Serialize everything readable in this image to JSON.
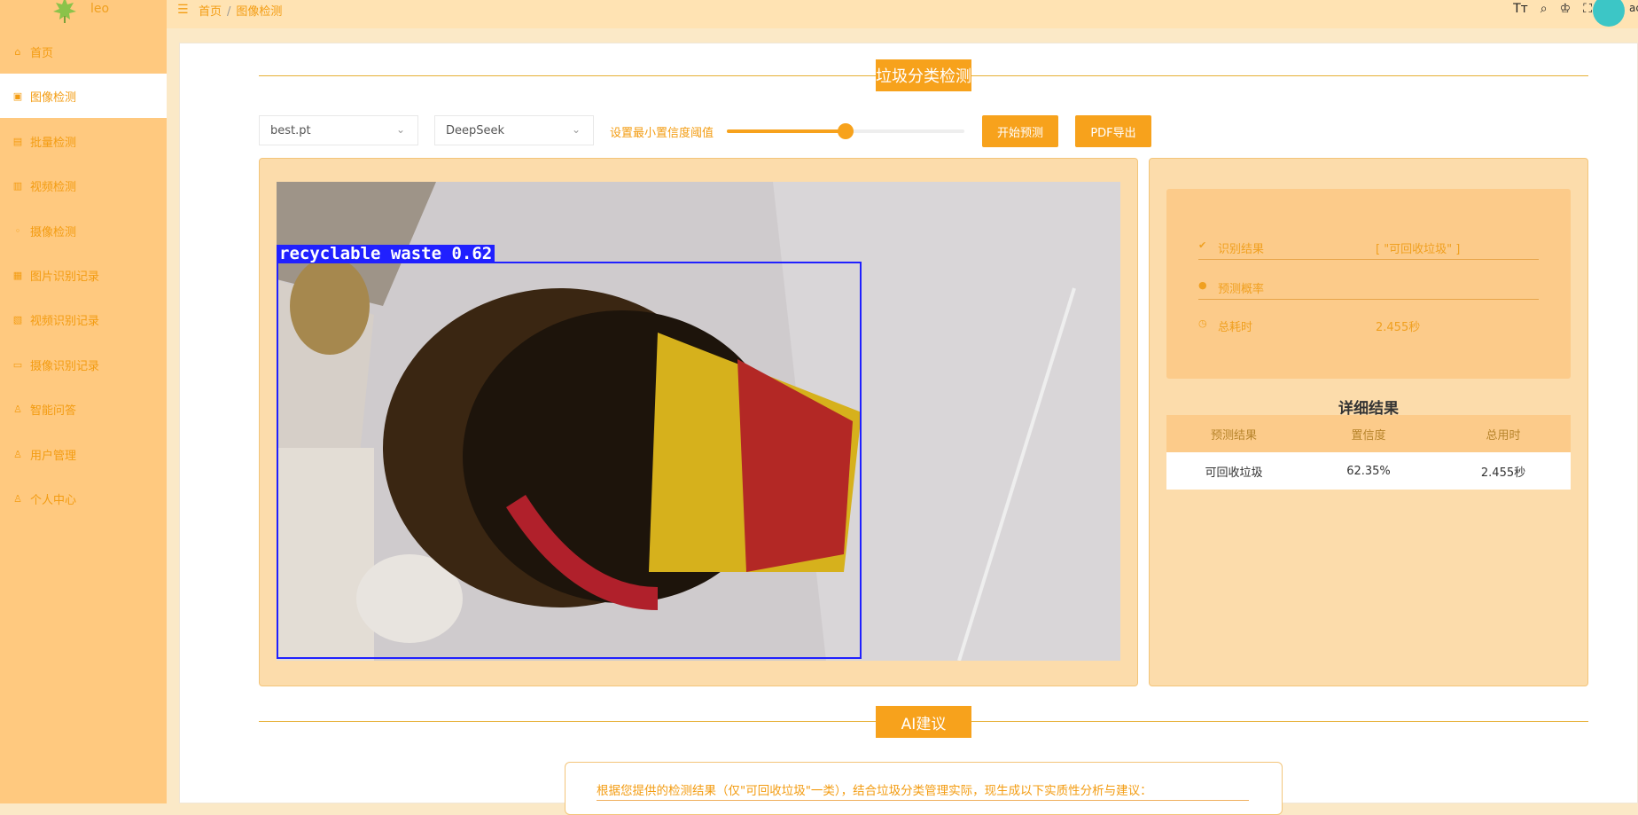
{
  "app": {
    "logo_text": "leo",
    "avatar_text": "ac"
  },
  "sidebar": {
    "items": [
      {
        "label": "首页",
        "icon": "home-icon"
      },
      {
        "label": "图像检测",
        "icon": "image-icon",
        "active": true
      },
      {
        "label": "批量检测",
        "icon": "grid-icon"
      },
      {
        "label": "视频检测",
        "icon": "video-icon"
      },
      {
        "label": "摄像检测",
        "icon": "camera-icon"
      },
      {
        "label": "图片识别记录",
        "icon": "document-icon"
      },
      {
        "label": "视频识别记录",
        "icon": "file-icon"
      },
      {
        "label": "摄像识别记录",
        "icon": "record-icon"
      },
      {
        "label": "智能问答",
        "icon": "chat-icon"
      },
      {
        "label": "用户管理",
        "icon": "user-icon"
      },
      {
        "label": "个人中心",
        "icon": "person-icon"
      }
    ]
  },
  "header": {
    "breadcrumb": [
      "首页",
      "图像检测"
    ],
    "icons": [
      "font-size-icon",
      "search-icon",
      "theme-icon",
      "fullscreen-icon"
    ]
  },
  "main": {
    "title": "垃圾分类检测",
    "model_select": "best.pt",
    "ai_select": "DeepSeek",
    "slider_label": "设置最小置信度阈值",
    "slider_value": 0.5,
    "start_button": "开始预测",
    "pdf_button": "PDF导出"
  },
  "detection": {
    "label": "recyclable waste 0.62",
    "box_color": "#2020ff"
  },
  "result": {
    "rows": [
      {
        "key": "识别结果",
        "value": "[ \"可回收垃圾\" ]",
        "icon": "check-icon"
      },
      {
        "key": "预测概率",
        "value": "",
        "icon": "bulb-icon"
      },
      {
        "key": "总耗时",
        "value": "2.455秒",
        "icon": "clock-icon"
      }
    ],
    "detail_title": "详细结果",
    "table": {
      "headers": [
        "预测结果",
        "置信度",
        "总用时"
      ],
      "rows": [
        [
          "可回收垃圾",
          "62.35%",
          "2.455秒"
        ]
      ]
    }
  },
  "ai": {
    "title": "AI建议",
    "text": "根据您提供的检测结果（仅\"可回收垃圾\"一类），结合垃圾分类管理实际，现生成以下实质性分析与建议："
  },
  "colors": {
    "accent": "#f7a21c",
    "sidebar": "#ffc97f",
    "panel": "#fcdcab"
  }
}
